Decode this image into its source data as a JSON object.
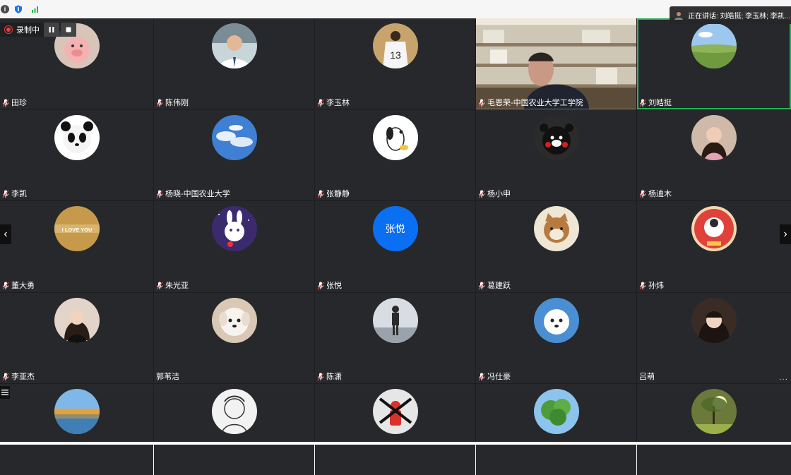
{
  "recording": {
    "label": "录制中"
  },
  "speaking": {
    "text": "正在讲话: 刘皓挺; 李玉林; 李凯..."
  },
  "tiles": [
    {
      "name": "田珍",
      "avatar": "pig"
    },
    {
      "name": "陈伟刚",
      "avatar": "man-portrait"
    },
    {
      "name": "李玉林",
      "avatar": "jersey-13"
    },
    {
      "name": "毛恩荣-中国农业大学工学院",
      "avatar": "video"
    },
    {
      "name": "刘皓挺",
      "avatar": "landscape",
      "active": true
    },
    {
      "name": "李凯",
      "avatar": "panda"
    },
    {
      "name": "杨晓-中国农业大学",
      "avatar": "clouds"
    },
    {
      "name": "张静静",
      "avatar": "snoopy"
    },
    {
      "name": "杨小申",
      "avatar": "kumamon"
    },
    {
      "name": "杨迪木",
      "avatar": "girl-pink"
    },
    {
      "name": "董大勇",
      "avatar": "i-love-you"
    },
    {
      "name": "朱光亚",
      "avatar": "bunny"
    },
    {
      "name": "张悦",
      "avatar": "text",
      "avatar_text": "张悦"
    },
    {
      "name": "葛建跃",
      "avatar": "cat"
    },
    {
      "name": "孙炜",
      "avatar": "chinese-new-year"
    },
    {
      "name": "李亚杰",
      "avatar": "woman-black"
    },
    {
      "name": "郭苇洁",
      "avatar": "dog-white",
      "no_mic": true
    },
    {
      "name": "陈潇",
      "avatar": "person-walking"
    },
    {
      "name": "冯仕豪",
      "avatar": "puppy"
    },
    {
      "name": "吕萌",
      "avatar": "girl-anime",
      "no_mic": true
    },
    {
      "name": "",
      "avatar": "lake"
    },
    {
      "name": "",
      "avatar": "sketch"
    },
    {
      "name": "",
      "avatar": "red-robot"
    },
    {
      "name": "",
      "avatar": "trees"
    },
    {
      "name": "",
      "avatar": "tree-sunlight"
    }
  ],
  "colors": {
    "active_border": "#27b35a",
    "tile_bg": "#27282b",
    "text_avatar": "#0b6ff2"
  }
}
